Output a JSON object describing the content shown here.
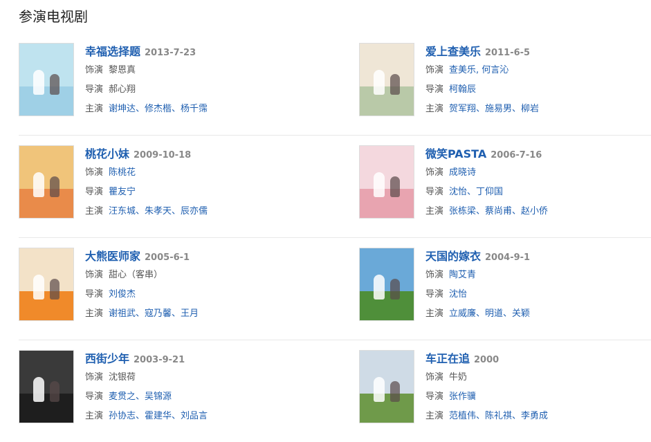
{
  "section": {
    "title": "参演电视剧"
  },
  "labels": {
    "role": "饰演",
    "director": "导演",
    "starring": "主演"
  },
  "items": [
    {
      "title": "幸福选择题",
      "date": "2013-7-23",
      "role": "黎恩真",
      "role_link": false,
      "director": "郝心翔",
      "director_link": false,
      "starring": "谢坤达、修杰楷、杨千霈",
      "poster_colors": [
        "#bfe3ef",
        "#9fd0e6"
      ]
    },
    {
      "title": "爱上查美乐",
      "date": "2011-6-5",
      "role": "查美乐, 何言沁",
      "role_link": true,
      "director": "柯翰辰",
      "director_link": true,
      "starring": "贺军翔、施易男、柳岩",
      "poster_colors": [
        "#efe6d6",
        "#b9c9a8"
      ]
    },
    {
      "title": "桃花小妹",
      "date": "2009-10-18",
      "role": "陈桃花",
      "role_link": true,
      "director": "瞿友宁",
      "director_link": true,
      "starring": "汪东城、朱孝天、辰亦儒",
      "poster_colors": [
        "#f0c47a",
        "#e98b4a"
      ]
    },
    {
      "title": "微笑PASTA",
      "date": "2006-7-16",
      "role": "成晓诗",
      "role_link": true,
      "director": "沈怡、丁仰国",
      "director_link": true,
      "starring": "张栋梁、蔡尚甫、赵小侨",
      "poster_colors": [
        "#f4d8de",
        "#e8a4b0"
      ]
    },
    {
      "title": "大熊医师家",
      "date": "2005-6-1",
      "role": "甜心（客串）",
      "role_link": false,
      "director": "刘俊杰",
      "director_link": true,
      "starring": "谢祖武、寇乃馨、王月",
      "poster_colors": [
        "#f3e2c8",
        "#f08a2a"
      ]
    },
    {
      "title": "天国的嫁衣",
      "date": "2004-9-1",
      "role": "陶艾青",
      "role_link": true,
      "director": "沈怡",
      "director_link": true,
      "starring": "立威廉、明道、关颖",
      "poster_colors": [
        "#6aa9d8",
        "#4f8f3a"
      ]
    },
    {
      "title": "西街少年",
      "date": "2003-9-21",
      "role": "沈银荷",
      "role_link": false,
      "director": "麦贯之、吴锦源",
      "director_link": true,
      "starring": "孙协志、霍建华、刘品言",
      "poster_colors": [
        "#3a3a3a",
        "#1e1e1e"
      ]
    },
    {
      "title": "车正在追",
      "date": "2000",
      "role": "牛奶",
      "role_link": false,
      "director": "张作骥",
      "director_link": true,
      "starring": "范植伟、陈礼祺、李勇成",
      "poster_colors": [
        "#cfdbe6",
        "#6f9a4a"
      ]
    }
  ]
}
